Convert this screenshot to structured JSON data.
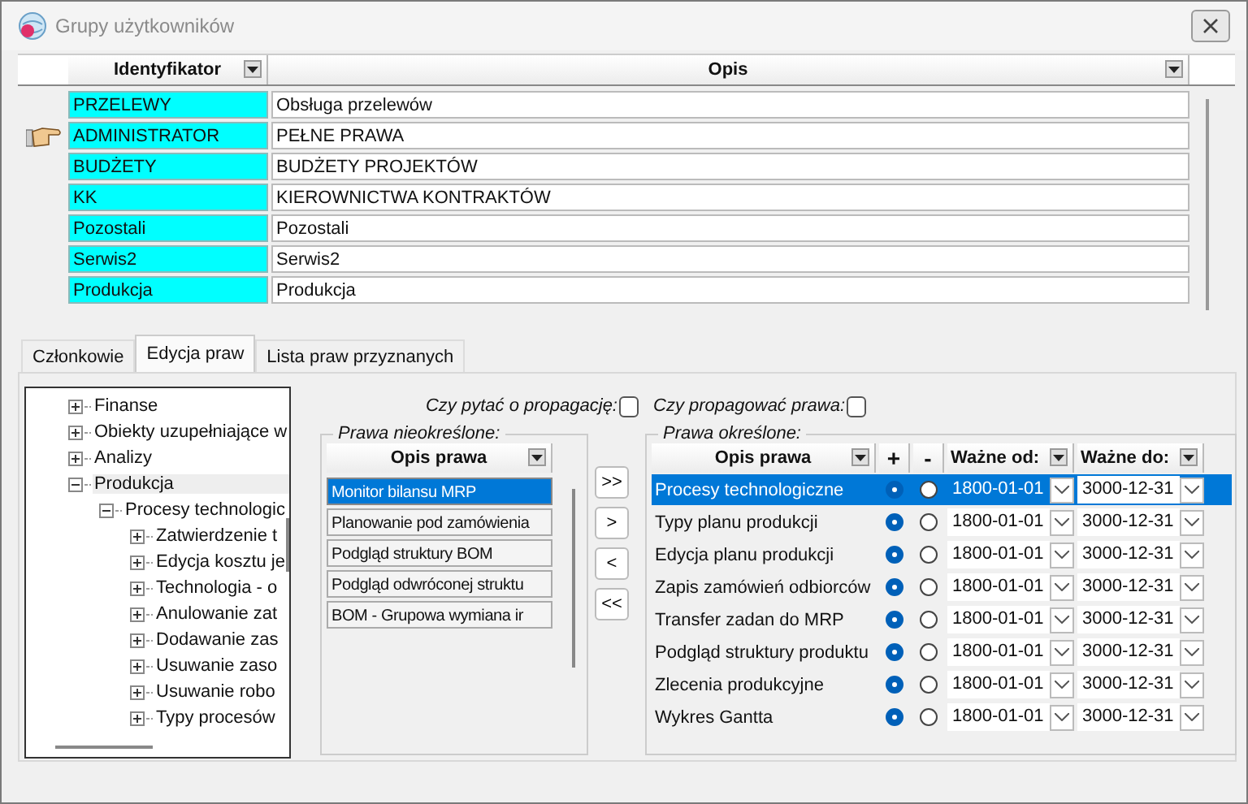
{
  "window": {
    "title": "Grupy użytkowników"
  },
  "groups_table": {
    "columns": [
      "Identyfikator",
      "Opis"
    ],
    "rows": [
      {
        "id": "PRZELEWY",
        "opis": "Obsługa przelewów",
        "current": false
      },
      {
        "id": "ADMINISTRATOR",
        "opis": "PEŁNE PRAWA",
        "current": true
      },
      {
        "id": "BUDŻETY",
        "opis": "BUDŻETY PROJEKTÓW",
        "current": false
      },
      {
        "id": "KK",
        "opis": "KIEROWNICTWA KONTRAKTÓW",
        "current": false
      },
      {
        "id": "Pozostali",
        "opis": "Pozostali",
        "current": false
      },
      {
        "id": "Serwis2",
        "opis": "Serwis2",
        "current": false
      },
      {
        "id": "Produkcja",
        "opis": "Produkcja",
        "current": false
      }
    ]
  },
  "tabs": [
    {
      "label": "Członkowie",
      "selected": false
    },
    {
      "label": "Edycja praw",
      "selected": true
    },
    {
      "label": "Lista praw przyznanych",
      "selected": false
    }
  ],
  "tree": [
    {
      "label": "Finanse",
      "expanded": false
    },
    {
      "label": "Obiekty uzupełniające w",
      "expanded": false
    },
    {
      "label": "Analizy",
      "expanded": false
    },
    {
      "label": "Produkcja",
      "expanded": true,
      "selected": true,
      "children": [
        {
          "label": "Procesy technologic",
          "expanded": true,
          "selected": false,
          "children": [
            {
              "label": "Zatwierdzenie t",
              "expanded": false
            },
            {
              "label": "Edycja kosztu je",
              "expanded": false
            },
            {
              "label": "Technologia - o",
              "expanded": false
            },
            {
              "label": "Anulowanie zat",
              "expanded": false
            },
            {
              "label": "Dodawanie zas",
              "expanded": false
            },
            {
              "label": "Usuwanie zaso",
              "expanded": false
            },
            {
              "label": "Usuwanie robo",
              "expanded": false
            },
            {
              "label": "Typy procesów",
              "expanded": false
            }
          ]
        }
      ]
    }
  ],
  "ask_propagation": {
    "label": "Czy pytać o propagację:",
    "checked": false
  },
  "propagate": {
    "label": "Czy propagować prawa:",
    "checked": false
  },
  "undefined_rights": {
    "legend": "Prawa nieokreślone:",
    "column": "Opis prawa",
    "rows": [
      {
        "label": "Monitor bilansu MRP",
        "selected": true
      },
      {
        "label": "Planowanie pod zamówienia",
        "selected": false
      },
      {
        "label": "Podgląd struktury BOM",
        "selected": false
      },
      {
        "label": "Podgląd odwróconej struktu",
        "selected": false
      },
      {
        "label": "BOM - Grupowa wymiana ir",
        "selected": false
      }
    ]
  },
  "move_buttons": [
    ">>",
    ">",
    "<",
    "<<"
  ],
  "defined_rights": {
    "legend": "Prawa określone:",
    "columns": [
      "Opis prawa",
      "+",
      "-",
      "Ważne od:",
      "Ważne do:"
    ],
    "rows": [
      {
        "label": "Procesy technologiczne",
        "plus": true,
        "minus": false,
        "from": "1800-01-01",
        "to": "3000-12-31",
        "selected": true
      },
      {
        "label": "Typy planu produkcji",
        "plus": true,
        "minus": false,
        "from": "1800-01-01",
        "to": "3000-12-31",
        "selected": false
      },
      {
        "label": "Edycja planu produkcji",
        "plus": true,
        "minus": false,
        "from": "1800-01-01",
        "to": "3000-12-31",
        "selected": false
      },
      {
        "label": "Zapis zamówień odbiorców",
        "plus": true,
        "minus": false,
        "from": "1800-01-01",
        "to": "3000-12-31",
        "selected": false
      },
      {
        "label": "Transfer zadan do MRP",
        "plus": true,
        "minus": false,
        "from": "1800-01-01",
        "to": "3000-12-31",
        "selected": false
      },
      {
        "label": "Podgląd struktury produktu",
        "plus": true,
        "minus": false,
        "from": "1800-01-01",
        "to": "3000-12-31",
        "selected": false
      },
      {
        "label": "Zlecenia produkcyjne",
        "plus": true,
        "minus": false,
        "from": "1800-01-01",
        "to": "3000-12-31",
        "selected": false
      },
      {
        "label": "Wykres Gantta",
        "plus": true,
        "minus": false,
        "from": "1800-01-01",
        "to": "3000-12-31",
        "selected": false
      }
    ]
  }
}
